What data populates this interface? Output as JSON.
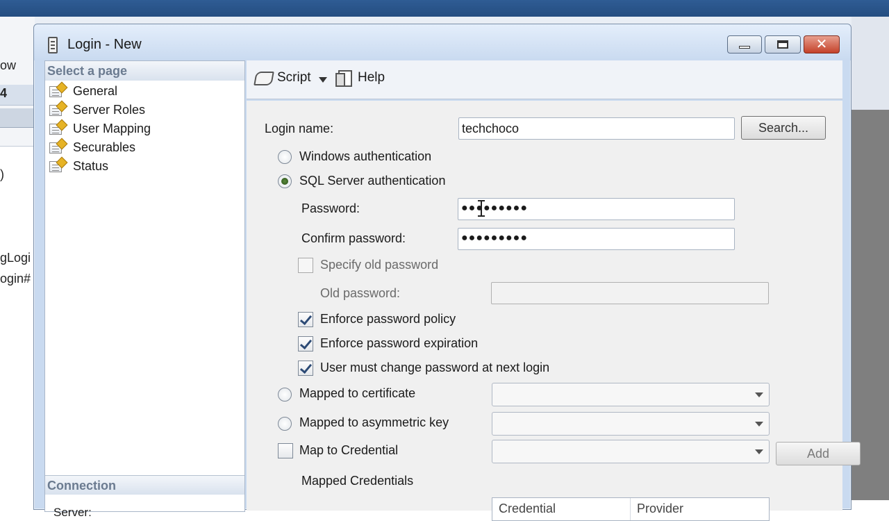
{
  "background": {
    "fragments": [
      "ow",
      "4",
      "gLogi",
      "ogin#",
      ")"
    ]
  },
  "window": {
    "title": "Login - New"
  },
  "left_pane": {
    "header": "Select a page",
    "pages": [
      "General",
      "Server Roles",
      "User Mapping",
      "Securables",
      "Status"
    ],
    "connection_header": "Connection",
    "server_label": "Server:"
  },
  "toolbar": {
    "script_label": "Script",
    "help_label": "Help"
  },
  "form": {
    "login_name_label": "Login name:",
    "login_name_value": "techchoco",
    "search_button": "Search...",
    "windows_auth_label": "Windows authentication",
    "sql_auth_label": "SQL Server authentication",
    "auth_selected": "SQL Server authentication",
    "password_label": "Password:",
    "password_value": "●●●●●●●●●",
    "confirm_password_label": "Confirm password:",
    "confirm_password_value": "●●●●●●●●●",
    "specify_old_label": "Specify old password",
    "old_password_label": "Old password:",
    "enforce_policy_label": "Enforce password policy",
    "enforce_expiration_label": "Enforce password expiration",
    "must_change_label": "User must change password at next login",
    "mapped_cert_label": "Mapped to certificate",
    "mapped_asym_label": "Mapped to asymmetric key",
    "map_credential_label": "Map to Credential",
    "add_button": "Add",
    "mapped_credentials_label": "Mapped Credentials",
    "columns": [
      "Credential",
      "Provider"
    ]
  },
  "colors": {
    "dialog_frame": "#c9daf0",
    "title_bar_top": "#2f5c94",
    "close_button": "#c4412a",
    "section_header_text": "#6b7b90"
  }
}
